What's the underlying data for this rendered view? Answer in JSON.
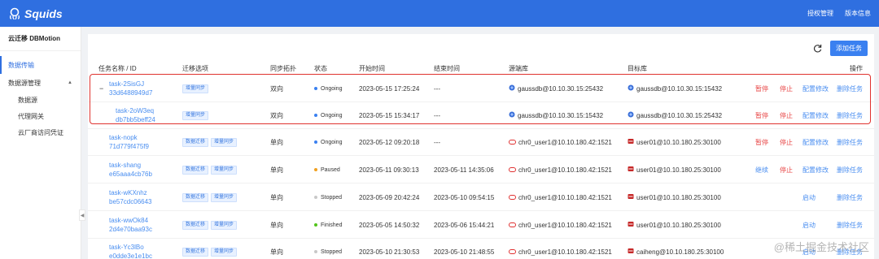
{
  "app": {
    "logo": "Squids",
    "top_links": [
      "授权管理",
      "版本信息"
    ]
  },
  "sidebar": {
    "title": "云迁移 DBMotion",
    "items": [
      {
        "label": "数据传输"
      },
      {
        "label": "数据源管理"
      },
      {
        "label": "数据源"
      },
      {
        "label": "代理网关"
      },
      {
        "label": "云厂商访问凭证"
      }
    ]
  },
  "toolbar": {
    "add_label": "添加任务"
  },
  "table": {
    "headers": [
      "任务名称 / ID",
      "迁移选项",
      "同步拓扑",
      "状态",
      "开始时间",
      "结束时间",
      "源端库",
      "目标库",
      "操作"
    ],
    "rows": [
      {
        "expand": "−",
        "name": "task-2SisGJ",
        "id": "33d6488949d7",
        "tags": [
          "增量同步"
        ],
        "topology": "双向",
        "status": "Ongoing",
        "status_color": "#3a80f0",
        "start": "2023-05-15 17:25:24",
        "end": "---",
        "source": "gaussdb@10.10.30.15:25432",
        "target": "gaussdb@10.10.30.15:15432",
        "actions": [
          "暂停",
          "停止",
          "配置修改",
          "删除任务"
        ]
      },
      {
        "expand": "",
        "name": "task-2oW3eq",
        "id": "db7bb5beff24",
        "tags": [
          "增量同步"
        ],
        "topology": "双向",
        "status": "Ongoing",
        "status_color": "#3a80f0",
        "start": "2023-05-15 15:34:17",
        "end": "---",
        "source": "gaussdb@10.10.30.15:15432",
        "target": "gaussdb@10.10.30.15:25432",
        "actions": [
          "暂停",
          "停止",
          "配置修改",
          "删除任务"
        ]
      },
      {
        "expand": "",
        "name": "task-nopk",
        "id": "71d779f475f9",
        "tags": [
          "数据迁移",
          "增量同步"
        ],
        "topology": "单向",
        "status": "Ongoing",
        "status_color": "#3a80f0",
        "start": "2023-05-12 09:20:18",
        "end": "---",
        "source": "chr0_user1@10.10.180.42:1521",
        "target": "user01@10.10.180.25:30100",
        "actions": [
          "暂停",
          "停止",
          "配置修改",
          "删除任务"
        ]
      },
      {
        "expand": "",
        "name": "task-shang",
        "id": "e65aaa4cb76b",
        "tags": [
          "数据迁移",
          "增量同步"
        ],
        "topology": "单向",
        "status": "Paused",
        "status_color": "#f0a020",
        "start": "2023-05-11 09:30:13",
        "end": "2023-05-11 14:35:06",
        "source": "chr0_user1@10.10.180.42:1521",
        "target": "user01@10.10.180.25:30100",
        "actions": [
          "继续",
          "停止",
          "配置修改",
          "删除任务"
        ]
      },
      {
        "expand": "",
        "name": "task-wKXnhz",
        "id": "be57cdc06643",
        "tags": [
          "数据迁移",
          "增量同步"
        ],
        "topology": "单向",
        "status": "Stopped",
        "status_color": "#c8c8c8",
        "start": "2023-05-09 20:42:24",
        "end": "2023-05-10 09:54:15",
        "source": "chr0_user1@10.10.180.42:1521",
        "target": "user01@10.10.180.25:30100",
        "actions": [
          "",
          "",
          "启动",
          "删除任务"
        ]
      },
      {
        "expand": "",
        "name": "task-wwOk84",
        "id": "2d4e70baa93c",
        "tags": [
          "数据迁移",
          "增量同步"
        ],
        "topology": "单向",
        "status": "Finished",
        "status_color": "#52c41a",
        "start": "2023-05-05 14:50:32",
        "end": "2023-05-06 15:44:21",
        "source": "chr0_user1@10.10.180.42:1521",
        "target": "user01@10.10.180.25:30100",
        "actions": [
          "",
          "",
          "启动",
          "删除任务"
        ]
      },
      {
        "expand": "",
        "name": "task-Yc3lBo",
        "id": "e0dde3e1e1bc",
        "tags": [
          "数据迁移",
          "增量同步"
        ],
        "topology": "单向",
        "status": "Stopped",
        "status_color": "#c8c8c8",
        "start": "2023-05-10 21:30:53",
        "end": "2023-05-10 21:48:55",
        "source": "chr0_user1@10.10.180.42:1521",
        "target": "caiheng@10.10.180.25:30100",
        "actions": [
          "",
          "",
          "启动",
          "删除任务"
        ]
      }
    ]
  },
  "watermark": "@稀土掘金技术社区",
  "colors": {
    "brand": "#2f6fe0",
    "link": "#4a8ef0",
    "danger": "#e84b4b",
    "highlight": "#e0332f"
  }
}
